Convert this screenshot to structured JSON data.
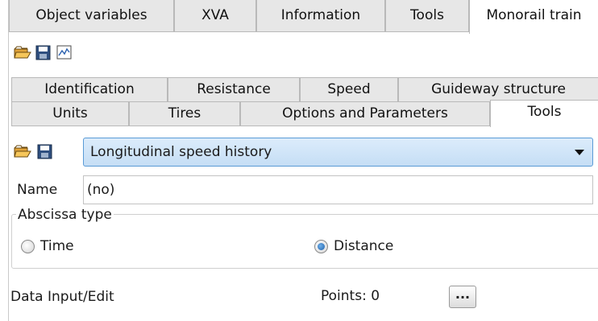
{
  "top_tabs": [
    {
      "label": "Object variables",
      "active": false
    },
    {
      "label": "XVA",
      "active": false
    },
    {
      "label": "Information",
      "active": false
    },
    {
      "label": "Tools",
      "active": false
    },
    {
      "label": "Monorail train",
      "active": true
    }
  ],
  "toolbar_icons": [
    "open-folder-icon",
    "save-disk-icon",
    "chart-graph-icon"
  ],
  "sub_tabs_row1": [
    {
      "label": "Identification",
      "active": false
    },
    {
      "label": "Resistance",
      "active": false
    },
    {
      "label": "Speed",
      "active": false
    },
    {
      "label": "Guideway structure",
      "active": false
    }
  ],
  "sub_tabs_row2": [
    {
      "label": "Units",
      "active": false
    },
    {
      "label": "Tires",
      "active": false
    },
    {
      "label": "Options and Parameters",
      "active": false
    },
    {
      "label": "Tools",
      "active": true
    }
  ],
  "tool_select": {
    "value": "Longitudinal speed history"
  },
  "name_row": {
    "label": "Name",
    "value": "(no)"
  },
  "abscissa": {
    "group_label": "Abscissa type",
    "options": [
      {
        "label": "Time",
        "checked": false
      },
      {
        "label": "Distance",
        "checked": true
      }
    ]
  },
  "data_input": {
    "label": "Data Input/Edit",
    "points_value": "Points: 0",
    "edit_button": "..."
  },
  "colors": {
    "tab_bg": "#e7e7e7",
    "dropdown_bg": "#c5def5",
    "dropdown_border": "#5a9bd6",
    "folder_icon": "#e0a33a",
    "disk_icon": "#2f4f7f",
    "radio_checked": "#1f5fa8"
  }
}
